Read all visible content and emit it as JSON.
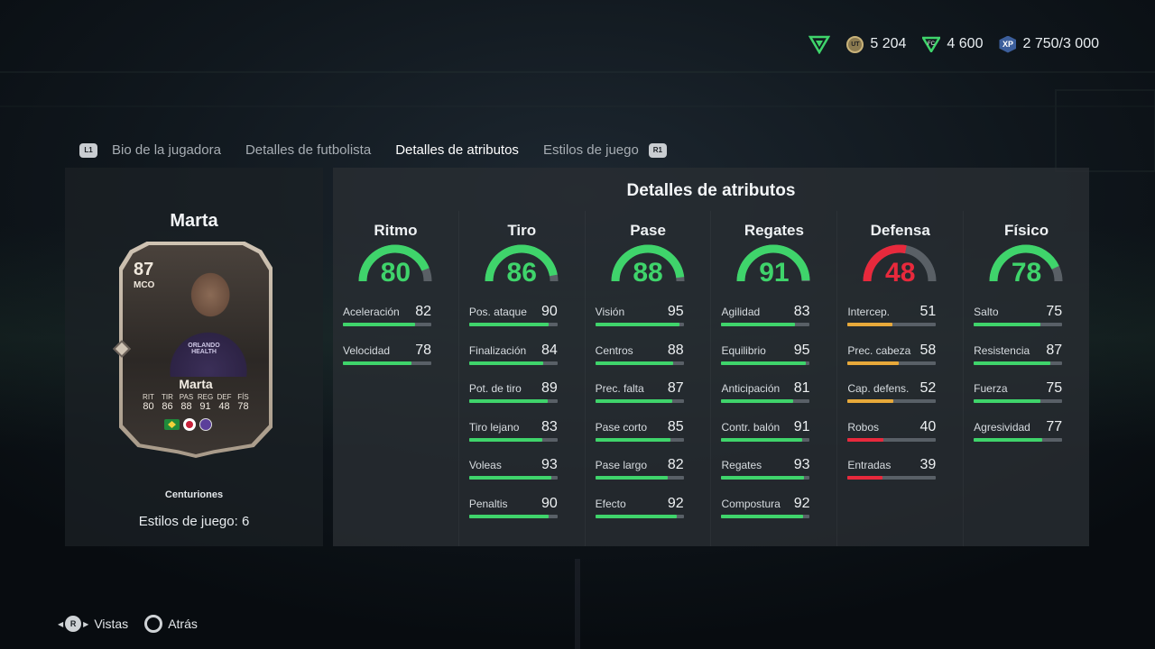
{
  "currency": {
    "coins": "5 204",
    "points": "4 600",
    "xp": "2 750/3 000"
  },
  "tabs": {
    "left_button": "L1",
    "right_button": "R1",
    "items": [
      {
        "label": "Bio de la jugadora"
      },
      {
        "label": "Detalles de futbolista"
      },
      {
        "label": "Detalles de atributos"
      },
      {
        "label": "Estilos de juego"
      }
    ],
    "active": "Detalles de atributos"
  },
  "player": {
    "name": "Marta",
    "card": {
      "rating": "87",
      "position": "MCO",
      "name": "Marta",
      "sponsor": "ORLANDO HEALTH",
      "stat_labels": [
        "RIT",
        "TIR",
        "PAS",
        "REG",
        "DEF",
        "FÍS"
      ],
      "stat_values": [
        "80",
        "86",
        "88",
        "91",
        "48",
        "78"
      ]
    },
    "card_type": "Centuriones",
    "playstyles": "Estilos de juego: 6"
  },
  "attributes": {
    "title": "Detalles de atributos",
    "categories": [
      {
        "name": "Ritmo",
        "value": 80,
        "color": "#3fd46b",
        "stats": [
          {
            "name": "Aceleración",
            "value": 82
          },
          {
            "name": "Velocidad",
            "value": 78
          }
        ]
      },
      {
        "name": "Tiro",
        "value": 86,
        "color": "#3fd46b",
        "stats": [
          {
            "name": "Pos. ataque",
            "value": 90
          },
          {
            "name": "Finalización",
            "value": 84
          },
          {
            "name": "Pot. de tiro",
            "value": 89
          },
          {
            "name": "Tiro lejano",
            "value": 83
          },
          {
            "name": "Voleas",
            "value": 93
          },
          {
            "name": "Penaltis",
            "value": 90
          }
        ]
      },
      {
        "name": "Pase",
        "value": 88,
        "color": "#3fd46b",
        "stats": [
          {
            "name": "Visión",
            "value": 95
          },
          {
            "name": "Centros",
            "value": 88
          },
          {
            "name": "Prec. falta",
            "value": 87
          },
          {
            "name": "Pase corto",
            "value": 85
          },
          {
            "name": "Pase largo",
            "value": 82
          },
          {
            "name": "Efecto",
            "value": 92
          }
        ]
      },
      {
        "name": "Regates",
        "value": 91,
        "color": "#3fd46b",
        "stats": [
          {
            "name": "Agilidad",
            "value": 83
          },
          {
            "name": "Equilibrio",
            "value": 95
          },
          {
            "name": "Anticipación",
            "value": 81
          },
          {
            "name": "Contr. balón",
            "value": 91
          },
          {
            "name": "Regates",
            "value": 93
          },
          {
            "name": "Compostura",
            "value": 92
          }
        ]
      },
      {
        "name": "Defensa",
        "value": 48,
        "color": "#e8293c",
        "stats": [
          {
            "name": "Intercep.",
            "value": 51
          },
          {
            "name": "Prec. cabeza",
            "value": 58
          },
          {
            "name": "Cap. defens.",
            "value": 52
          },
          {
            "name": "Robos",
            "value": 40
          },
          {
            "name": "Entradas",
            "value": 39
          }
        ]
      },
      {
        "name": "Físico",
        "value": 78,
        "color": "#3fd46b",
        "stats": [
          {
            "name": "Salto",
            "value": 75
          },
          {
            "name": "Resistencia",
            "value": 87
          },
          {
            "name": "Fuerza",
            "value": 75
          },
          {
            "name": "Agresividad",
            "value": 77
          }
        ]
      }
    ]
  },
  "footer": {
    "views_button": "R",
    "views_label": "Vistas",
    "back_label": "Atrás"
  },
  "colors": {
    "green": "#3fd46b",
    "orange": "#e8a93a",
    "red": "#e8293c"
  }
}
